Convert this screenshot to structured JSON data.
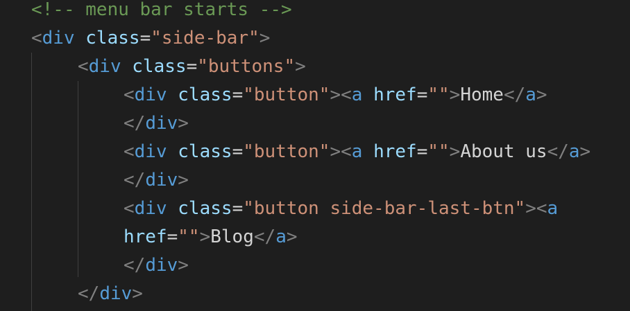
{
  "editor": {
    "background": "#1e1e1e",
    "colors": {
      "comment": "#6a9955",
      "punctuation": "#808080",
      "tag": "#569cd6",
      "attribute": "#9cdcfe",
      "string": "#ce9178",
      "text": "#d4d4d4"
    },
    "lines": [
      {
        "tokens": [
          {
            "t": "cm",
            "v": "<!-- menu bar starts -->"
          }
        ]
      },
      {
        "tokens": [
          {
            "t": "pn",
            "v": "<"
          },
          {
            "t": "tg",
            "v": "div"
          },
          {
            "t": "tx",
            "v": " "
          },
          {
            "t": "at",
            "v": "class"
          },
          {
            "t": "op",
            "v": "="
          },
          {
            "t": "st",
            "v": "\"side-bar\""
          },
          {
            "t": "pn",
            "v": ">"
          }
        ]
      },
      {
        "tokens": [
          {
            "t": "pn",
            "v": "<"
          },
          {
            "t": "tg",
            "v": "div"
          },
          {
            "t": "tx",
            "v": " "
          },
          {
            "t": "at",
            "v": "class"
          },
          {
            "t": "op",
            "v": "="
          },
          {
            "t": "st",
            "v": "\"buttons\""
          },
          {
            "t": "pn",
            "v": ">"
          }
        ]
      },
      {
        "tokens": [
          {
            "t": "pn",
            "v": "<"
          },
          {
            "t": "tg",
            "v": "div"
          },
          {
            "t": "tx",
            "v": " "
          },
          {
            "t": "at",
            "v": "class"
          },
          {
            "t": "op",
            "v": "="
          },
          {
            "t": "st",
            "v": "\"button\""
          },
          {
            "t": "pn",
            "v": "><"
          },
          {
            "t": "tg",
            "v": "a"
          },
          {
            "t": "tx",
            "v": " "
          },
          {
            "t": "at",
            "v": "href"
          },
          {
            "t": "op",
            "v": "="
          },
          {
            "t": "st",
            "v": "\"\""
          },
          {
            "t": "pn",
            "v": ">"
          },
          {
            "t": "tx",
            "v": "Home"
          },
          {
            "t": "pn",
            "v": "</"
          },
          {
            "t": "tg",
            "v": "a"
          },
          {
            "t": "pn",
            "v": ">"
          }
        ]
      },
      {
        "tokens": [
          {
            "t": "pn",
            "v": "</"
          },
          {
            "t": "tg",
            "v": "div"
          },
          {
            "t": "pn",
            "v": ">"
          }
        ]
      },
      {
        "tokens": [
          {
            "t": "pn",
            "v": "<"
          },
          {
            "t": "tg",
            "v": "div"
          },
          {
            "t": "tx",
            "v": " "
          },
          {
            "t": "at",
            "v": "class"
          },
          {
            "t": "op",
            "v": "="
          },
          {
            "t": "st",
            "v": "\"button\""
          },
          {
            "t": "pn",
            "v": "><"
          },
          {
            "t": "tg",
            "v": "a"
          },
          {
            "t": "tx",
            "v": " "
          },
          {
            "t": "at",
            "v": "href"
          },
          {
            "t": "op",
            "v": "="
          },
          {
            "t": "st",
            "v": "\"\""
          },
          {
            "t": "pn",
            "v": ">"
          },
          {
            "t": "tx",
            "v": "About us"
          },
          {
            "t": "pn",
            "v": "</"
          },
          {
            "t": "tg",
            "v": "a"
          },
          {
            "t": "pn",
            "v": ">"
          }
        ]
      },
      {
        "tokens": [
          {
            "t": "pn",
            "v": "</"
          },
          {
            "t": "tg",
            "v": "div"
          },
          {
            "t": "pn",
            "v": ">"
          }
        ]
      },
      {
        "tokens": [
          {
            "t": "pn",
            "v": "<"
          },
          {
            "t": "tg",
            "v": "div"
          },
          {
            "t": "tx",
            "v": " "
          },
          {
            "t": "at",
            "v": "class"
          },
          {
            "t": "op",
            "v": "="
          },
          {
            "t": "st",
            "v": "\"button side-bar-last-btn\""
          },
          {
            "t": "pn",
            "v": "><"
          },
          {
            "t": "tg",
            "v": "a"
          }
        ]
      },
      {
        "tokens": [
          {
            "t": "at",
            "v": "href"
          },
          {
            "t": "op",
            "v": "="
          },
          {
            "t": "st",
            "v": "\"\""
          },
          {
            "t": "pn",
            "v": ">"
          },
          {
            "t": "tx",
            "v": "Blog"
          },
          {
            "t": "pn",
            "v": "</"
          },
          {
            "t": "tg",
            "v": "a"
          },
          {
            "t": "pn",
            "v": ">"
          }
        ]
      },
      {
        "tokens": [
          {
            "t": "pn",
            "v": "</"
          },
          {
            "t": "tg",
            "v": "div"
          },
          {
            "t": "pn",
            "v": ">"
          }
        ]
      },
      {
        "tokens": [
          {
            "t": "pn",
            "v": "</"
          },
          {
            "t": "tg",
            "v": "div"
          },
          {
            "t": "pn",
            "v": ">"
          }
        ]
      }
    ]
  }
}
